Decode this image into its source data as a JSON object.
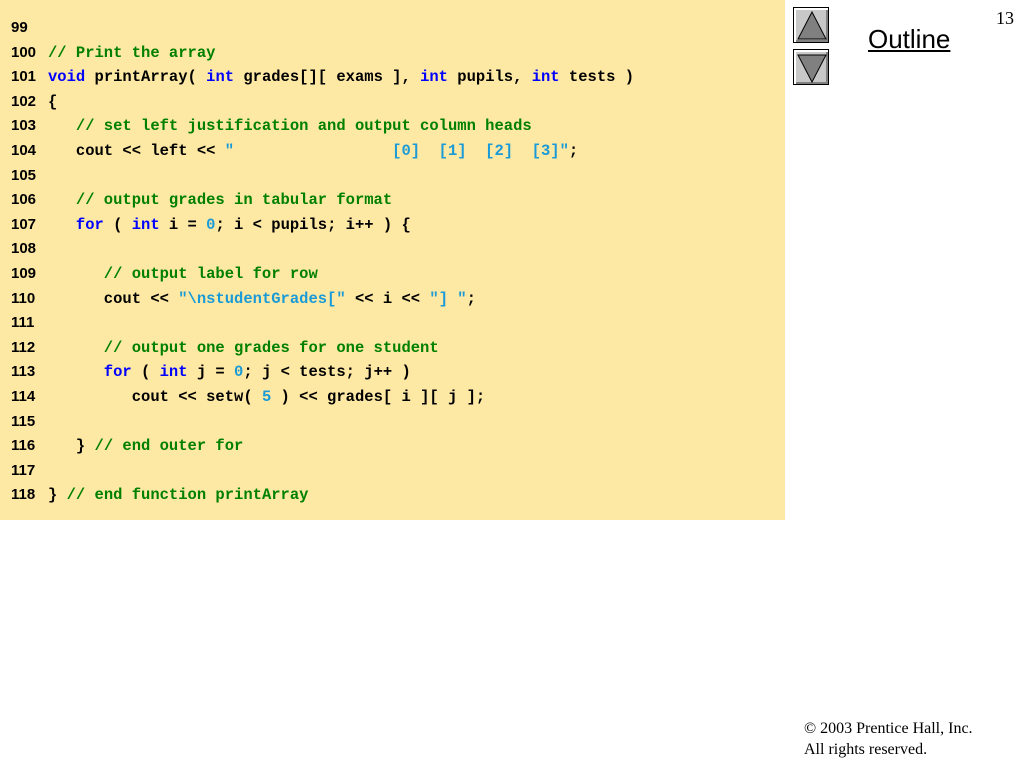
{
  "slide": {
    "page_number": "13",
    "outline_label": "Outline",
    "copyright_line1": "© 2003 Prentice Hall, Inc.",
    "copyright_line2": "All rights reserved."
  },
  "nav": {
    "up_icon": "triangle-up-icon",
    "down_icon": "triangle-down-icon"
  },
  "colors": {
    "panel_background": "#fde8a4",
    "keyword": "#0000ff",
    "comment": "#008000",
    "string": "#1a9bd7"
  },
  "code_lines": [
    {
      "num": "99",
      "tokens": []
    },
    {
      "num": "100",
      "tokens": [
        {
          "t": "c",
          "v": "// Print the array"
        }
      ]
    },
    {
      "num": "101",
      "tokens": [
        {
          "t": "k",
          "v": "void"
        },
        {
          "t": "p",
          "v": " printArray( "
        },
        {
          "t": "k",
          "v": "int"
        },
        {
          "t": "p",
          "v": " grades[][ exams ], "
        },
        {
          "t": "k",
          "v": "int"
        },
        {
          "t": "p",
          "v": " pupils, "
        },
        {
          "t": "k",
          "v": "int"
        },
        {
          "t": "p",
          "v": " tests )"
        }
      ]
    },
    {
      "num": "102",
      "tokens": [
        {
          "t": "p",
          "v": "{"
        }
      ]
    },
    {
      "num": "103",
      "tokens": [
        {
          "t": "c",
          "v": "   // set left justification and output column heads"
        }
      ]
    },
    {
      "num": "104",
      "tokens": [
        {
          "t": "p",
          "v": "   cout << left << "
        },
        {
          "t": "s",
          "v": "\"                 [0]  [1]  [2]  [3]\""
        },
        {
          "t": "p",
          "v": ";"
        }
      ]
    },
    {
      "num": "105",
      "tokens": []
    },
    {
      "num": "106",
      "tokens": [
        {
          "t": "c",
          "v": "   // output grades in tabular format"
        }
      ]
    },
    {
      "num": "107",
      "tokens": [
        {
          "t": "k",
          "v": "   for"
        },
        {
          "t": "p",
          "v": " ( "
        },
        {
          "t": "k",
          "v": "int"
        },
        {
          "t": "p",
          "v": " i = "
        },
        {
          "t": "n",
          "v": "0"
        },
        {
          "t": "p",
          "v": "; i < pupils; i++ ) {"
        }
      ]
    },
    {
      "num": "108",
      "tokens": []
    },
    {
      "num": "109",
      "tokens": [
        {
          "t": "c",
          "v": "      // output label for row"
        }
      ]
    },
    {
      "num": "110",
      "tokens": [
        {
          "t": "p",
          "v": "      cout << "
        },
        {
          "t": "s",
          "v": "\"\\nstudentGrades[\""
        },
        {
          "t": "p",
          "v": " << i << "
        },
        {
          "t": "s",
          "v": "\"] \""
        },
        {
          "t": "p",
          "v": ";"
        }
      ]
    },
    {
      "num": "111",
      "tokens": []
    },
    {
      "num": "112",
      "tokens": [
        {
          "t": "c",
          "v": "      // output one grades for one student"
        }
      ]
    },
    {
      "num": "113",
      "tokens": [
        {
          "t": "k",
          "v": "      for"
        },
        {
          "t": "p",
          "v": " ( "
        },
        {
          "t": "k",
          "v": "int"
        },
        {
          "t": "p",
          "v": " j = "
        },
        {
          "t": "n",
          "v": "0"
        },
        {
          "t": "p",
          "v": "; j < tests; j++ )"
        }
      ]
    },
    {
      "num": "114",
      "tokens": [
        {
          "t": "p",
          "v": "         cout << setw( "
        },
        {
          "t": "n",
          "v": "5"
        },
        {
          "t": "p",
          "v": " ) << grades[ i ][ j ];"
        }
      ]
    },
    {
      "num": "115",
      "tokens": []
    },
    {
      "num": "116",
      "tokens": [
        {
          "t": "p",
          "v": "   } "
        },
        {
          "t": "c",
          "v": "// end outer for"
        }
      ]
    },
    {
      "num": "117",
      "tokens": []
    },
    {
      "num": "118",
      "tokens": [
        {
          "t": "p",
          "v": "} "
        },
        {
          "t": "c",
          "v": "// end function printArray"
        }
      ]
    }
  ]
}
